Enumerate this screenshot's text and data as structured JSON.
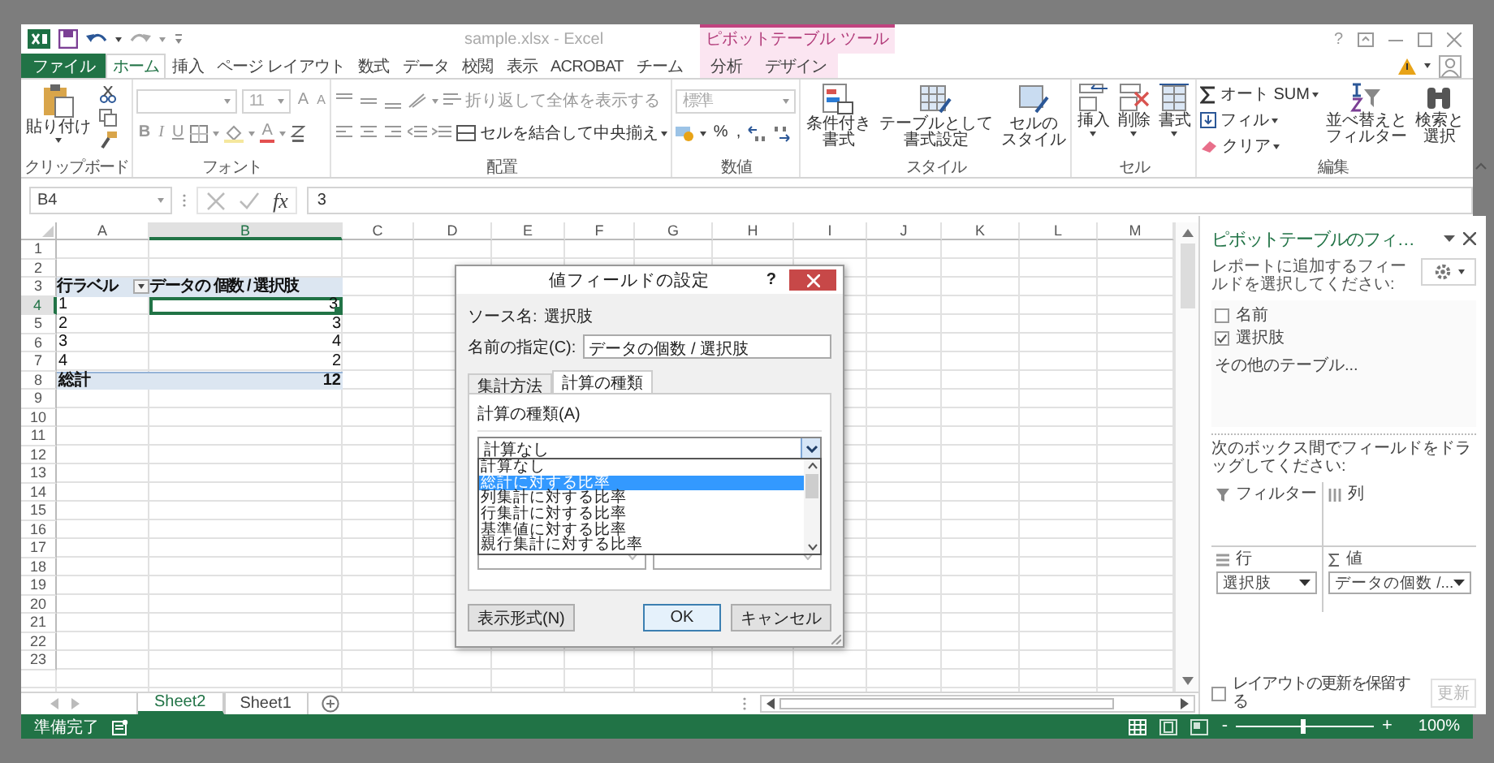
{
  "window": {
    "title": "sample.xlsx - Excel",
    "tool_group": "ピボットテーブル ツール",
    "help": "?"
  },
  "ribbon_tabs": [
    {
      "label": "ファイル",
      "kind": "file",
      "selected": false
    },
    {
      "label": "ホーム",
      "kind": "normal",
      "selected": true
    },
    {
      "label": "挿入",
      "kind": "normal",
      "selected": false
    },
    {
      "label": "ページ レイアウト",
      "kind": "normal",
      "selected": false
    },
    {
      "label": "数式",
      "kind": "normal",
      "selected": false
    },
    {
      "label": "データ",
      "kind": "normal",
      "selected": false
    },
    {
      "label": "校閲",
      "kind": "normal",
      "selected": false
    },
    {
      "label": "表示",
      "kind": "normal",
      "selected": false
    },
    {
      "label": "ACROBAT",
      "kind": "normal",
      "selected": false
    },
    {
      "label": "チーム",
      "kind": "normal",
      "selected": false
    },
    {
      "label": "分析",
      "kind": "context",
      "selected": false
    },
    {
      "label": "デザイン",
      "kind": "context",
      "selected": false
    }
  ],
  "ribbon": {
    "clipboard": {
      "label": "クリップボード",
      "paste": "貼り付け"
    },
    "font": {
      "label": "フォント",
      "size": "11",
      "grow": "A",
      "shrink": "A",
      "styles": [
        "B",
        "I",
        "U"
      ],
      "font_color_button": "A"
    },
    "alignment": {
      "label": "配置",
      "wrap": "折り返して全体を表示する",
      "merge": "セルを結合して中央揃え"
    },
    "number": {
      "label": "数値",
      "format": "標準",
      "percent": "%",
      "comma": ","
    },
    "styles": {
      "label": "スタイル",
      "buttons": [
        {
          "lines": [
            "条件付き",
            "書式"
          ]
        },
        {
          "lines": [
            "テーブルとして",
            "書式設定"
          ]
        },
        {
          "lines": [
            "セルの",
            "スタイル"
          ]
        }
      ]
    },
    "cells": {
      "label": "セル",
      "buttons": [
        "挿入",
        "削除",
        "書式"
      ]
    },
    "editing": {
      "label": "編集",
      "autosum": "オート SUM",
      "fill": "フィル",
      "clear": "クリア",
      "sort": [
        "並べ替えと",
        "フィルター"
      ],
      "find": [
        "検索と",
        "選択"
      ]
    }
  },
  "formula_bar": {
    "name_box": "B4",
    "function_label": "fx",
    "value": "3"
  },
  "sheet": {
    "columns": [
      {
        "label": "A",
        "selected": false
      },
      {
        "label": "B",
        "selected": true
      },
      {
        "label": "C",
        "selected": false
      },
      {
        "label": "D",
        "selected": false
      },
      {
        "label": "E",
        "selected": false
      },
      {
        "label": "F",
        "selected": false
      },
      {
        "label": "G",
        "selected": false
      },
      {
        "label": "H",
        "selected": false
      },
      {
        "label": "I",
        "selected": false
      },
      {
        "label": "J",
        "selected": false
      },
      {
        "label": "K",
        "selected": false
      },
      {
        "label": "L",
        "selected": false
      },
      {
        "label": "M",
        "selected": false
      }
    ],
    "rows": [
      {
        "label": "1",
        "selected": false
      },
      {
        "label": "2",
        "selected": false
      },
      {
        "label": "3",
        "selected": false
      },
      {
        "label": "4",
        "selected": true
      },
      {
        "label": "5",
        "selected": false
      },
      {
        "label": "6",
        "selected": false
      },
      {
        "label": "7",
        "selected": false
      },
      {
        "label": "8",
        "selected": false
      },
      {
        "label": "9",
        "selected": false
      },
      {
        "label": "10",
        "selected": false
      },
      {
        "label": "11",
        "selected": false
      },
      {
        "label": "12",
        "selected": false
      },
      {
        "label": "13",
        "selected": false
      },
      {
        "label": "14",
        "selected": false
      },
      {
        "label": "15",
        "selected": false
      },
      {
        "label": "16",
        "selected": false
      },
      {
        "label": "17",
        "selected": false
      },
      {
        "label": "18",
        "selected": false
      },
      {
        "label": "19",
        "selected": false
      },
      {
        "label": "20",
        "selected": false
      },
      {
        "label": "21",
        "selected": false
      },
      {
        "label": "22",
        "selected": false
      },
      {
        "label": "23",
        "selected": false
      }
    ],
    "pivot": {
      "row_header": "行ラベル",
      "value_header": "データの 個数 / 選択肢",
      "rows": [
        {
          "label": "1",
          "value": "3",
          "selected": true
        },
        {
          "label": "2",
          "value": "3",
          "selected": false
        },
        {
          "label": "3",
          "value": "4",
          "selected": false
        },
        {
          "label": "4",
          "value": "2",
          "selected": false
        }
      ],
      "total": {
        "label": "総計",
        "value": "12"
      }
    }
  },
  "sheet_tabs": [
    {
      "label": "Sheet2",
      "selected": true
    },
    {
      "label": "Sheet1",
      "selected": false
    }
  ],
  "dialog": {
    "title": "値フィールドの設定",
    "help": "?",
    "source_label": "ソース名:",
    "source_name": "選択肢",
    "name_label": "名前の指定(C):",
    "name_value": "データの個数 / 選択肢",
    "tabs": [
      {
        "label": "集計方法",
        "selected": false
      },
      {
        "label": "計算の種類",
        "selected": true
      }
    ],
    "calc_label": "計算の種類(A)",
    "calc_value": "計算なし",
    "calc_options": [
      {
        "label": "計算なし",
        "selected": false
      },
      {
        "label": "総計に対する比率",
        "selected": true
      },
      {
        "label": "列集計に対する比率",
        "selected": false
      },
      {
        "label": "行集計に対する比率",
        "selected": false
      },
      {
        "label": "基準値に対する比率",
        "selected": false
      },
      {
        "label": "親行集計に対する比率",
        "selected": false
      }
    ],
    "number_format_button": "表示形式(N)",
    "ok": "OK",
    "cancel": "キャンセル"
  },
  "field_pane": {
    "title": "ピボットテーブルのフィ…",
    "instructions": "レポートに追加するフィールドを選択してください:",
    "fields": [
      {
        "name": "名前",
        "checked": false
      },
      {
        "name": "選択肢",
        "checked": true
      }
    ],
    "more_tables": "その他のテーブル...",
    "drag_hint": "次のボックス間でフィールドをドラッグしてください:",
    "areas": [
      {
        "label": "フィルター",
        "kind": "filter"
      },
      {
        "label": "列",
        "kind": "columns"
      },
      {
        "label": "行",
        "kind": "rows",
        "items": [
          "選択肢"
        ]
      },
      {
        "label": "値",
        "kind": "values",
        "items": [
          "データの個数 /..."
        ]
      }
    ],
    "defer_label": "レイアウトの更新を保留する",
    "defer_checked": false,
    "update_button": "更新",
    "update_disabled": true
  },
  "status_bar": {
    "status": "準備完了",
    "zoom_out": "-",
    "zoom_in": "+",
    "zoom": {
      "level": 0.5,
      "reading": "100%"
    }
  }
}
